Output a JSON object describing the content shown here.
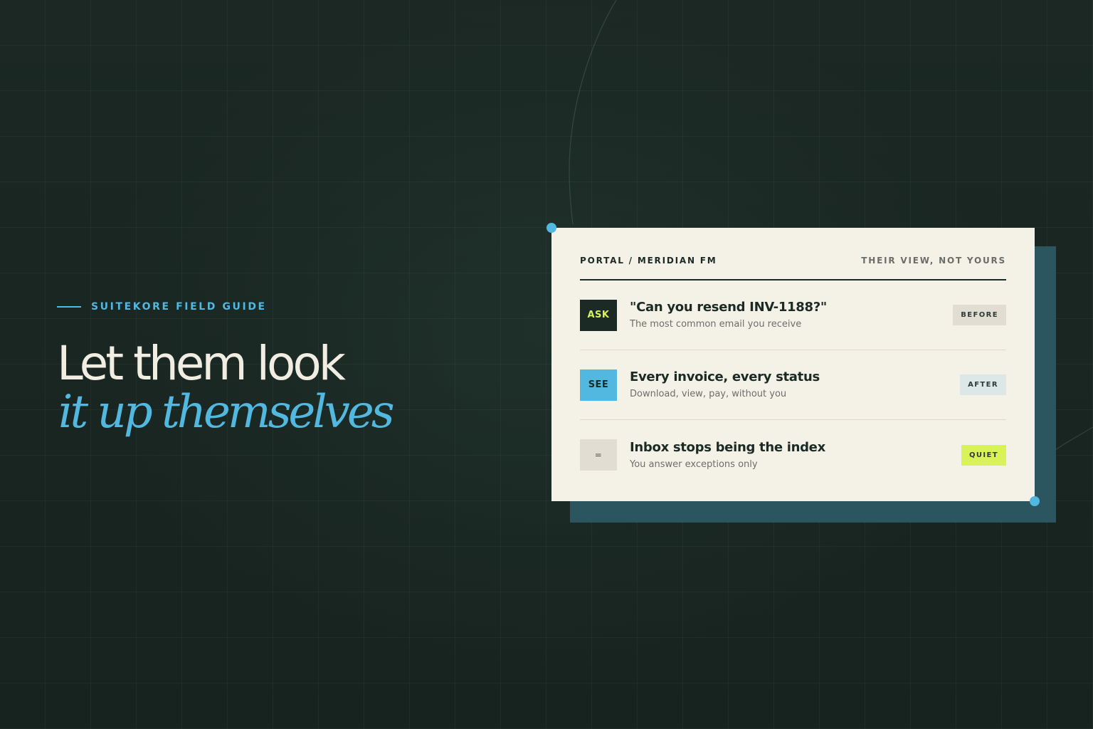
{
  "kicker": "SUITEKORE FIELD GUIDE",
  "headline": {
    "line1": "Let them look",
    "line2": "it up themselves"
  },
  "card": {
    "header_left": "PORTAL / MERIDIAN FM",
    "header_right": "THEIR VIEW, NOT YOURS",
    "rows": [
      {
        "icon_label": "ASK",
        "title": "\"Can you resend INV-1188?\"",
        "subtitle": "The most common email you receive",
        "tag": "BEFORE"
      },
      {
        "icon_label": "SEE",
        "title": "Every invoice, every status",
        "subtitle": "Download, view, pay, without you",
        "tag": "AFTER"
      },
      {
        "icon_label": "=",
        "title": "Inbox stops being the index",
        "subtitle": "You answer exceptions only",
        "tag": "QUIET"
      }
    ]
  },
  "colors": {
    "background": "#1a2622",
    "accent_blue": "#52b8e0",
    "accent_lime": "#d9f25a",
    "card": "#f4f1e7",
    "card_shadow": "#2b5660",
    "ink": "#1c2a25",
    "ask_bg": "#1c2a25",
    "ask_fg": "#d9f25a",
    "see_bg": "#52b8e0",
    "see_fg": "#1c2a25",
    "equal_bg": "#e1ddd2",
    "equal_fg": "#4a504c",
    "before_tag_bg": "#e1ddd2",
    "after_tag_bg": "#dbe8e7",
    "quiet_tag_bg": "#d9f25a"
  }
}
